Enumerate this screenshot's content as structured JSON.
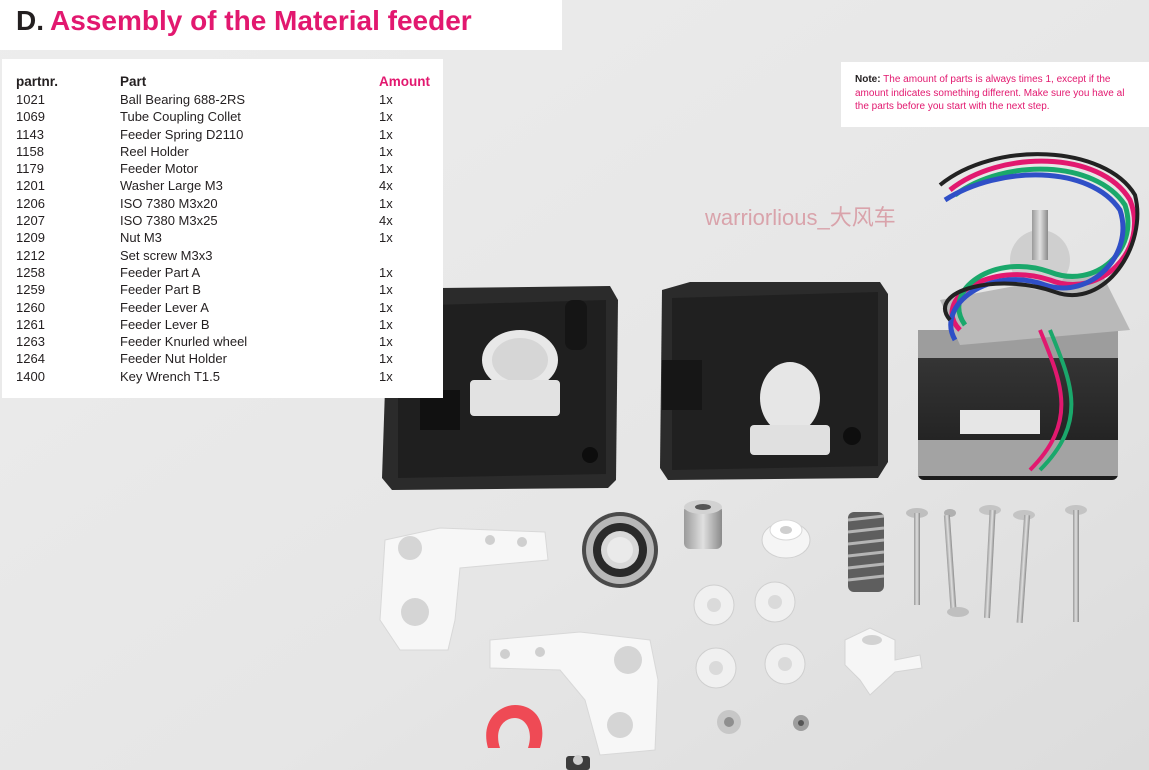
{
  "title": {
    "letter": "D.",
    "text": "Assembly of the Material feeder"
  },
  "parts_table": {
    "headers": {
      "partnr": "partnr.",
      "part": "Part",
      "amount": "Amount"
    },
    "rows": [
      {
        "partnr": "1021",
        "part": "Ball Bearing 688-2RS",
        "amount": "1x"
      },
      {
        "partnr": "1069",
        "part": "Tube Coupling Collet",
        "amount": "1x"
      },
      {
        "partnr": "1143",
        "part": "Feeder Spring D2110",
        "amount": "1x"
      },
      {
        "partnr": "1158",
        "part": "Reel Holder",
        "amount": "1x"
      },
      {
        "partnr": "1179",
        "part": "Feeder Motor",
        "amount": "1x"
      },
      {
        "partnr": "1201",
        "part": "Washer Large M3",
        "amount": "4x"
      },
      {
        "partnr": "1206",
        "part": "ISO 7380 M3x20",
        "amount": "1x"
      },
      {
        "partnr": "1207",
        "part": "ISO 7380 M3x25",
        "amount": "4x"
      },
      {
        "partnr": "1209",
        "part": "Nut M3",
        "amount": "1x"
      },
      {
        "partnr": "1212",
        "part": "Set screw M3x3",
        "amount": ""
      },
      {
        "partnr": "1258",
        "part": "Feeder Part A",
        "amount": "1x"
      },
      {
        "partnr": "1259",
        "part": "Feeder Part B",
        "amount": "1x"
      },
      {
        "partnr": "1260",
        "part": "Feeder Lever A",
        "amount": "1x"
      },
      {
        "partnr": "1261",
        "part": "Feeder Lever B",
        "amount": "1x"
      },
      {
        "partnr": "1263",
        "part": "Feeder Knurled wheel",
        "amount": "1x"
      },
      {
        "partnr": "1264",
        "part": "Feeder Nut Holder",
        "amount": "1x"
      },
      {
        "partnr": "1400",
        "part": "Key Wrench T1.5",
        "amount": "1x"
      }
    ]
  },
  "note": {
    "label": "Note:",
    "text": "The amount of parts is always times 1, except if the amount indicates something different. Make sure you have al the parts before you start with the next step."
  },
  "watermark": "warriorlious_大风车",
  "colors": {
    "accent": "#e2186f",
    "text": "#231f20",
    "background": "#eaeaea"
  }
}
